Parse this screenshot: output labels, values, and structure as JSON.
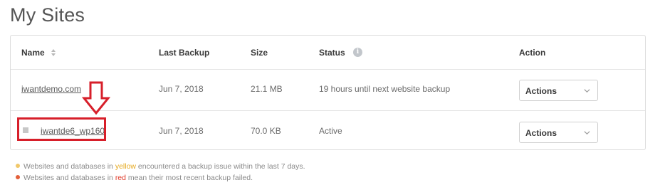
{
  "page": {
    "title": "My Sites"
  },
  "table": {
    "headers": {
      "name": "Name",
      "last_backup": "Last Backup",
      "size": "Size",
      "status": "Status",
      "action": "Action"
    },
    "rows": [
      {
        "name": "iwantdemo.com",
        "last_backup": "Jun 7, 2018",
        "size": "21.1 MB",
        "status": "19 hours until next website backup",
        "action": "Actions"
      },
      {
        "name": "iwantde6_wp160",
        "last_backup": "Jun 7, 2018",
        "size": "70.0 KB",
        "status": "Active",
        "action": "Actions"
      }
    ]
  },
  "legend": {
    "yellow": {
      "prefix": "Websites and databases in ",
      "keyword": "yellow",
      "suffix": " encountered a backup issue within the last 7 days.",
      "color": "#f1c86a"
    },
    "red": {
      "prefix": "Websites and databases in ",
      "keyword": "red",
      "suffix": " mean their most recent backup failed.",
      "color": "#e3603a"
    }
  },
  "icons": {
    "sort": "sort-icon",
    "info": "info-icon",
    "chevron": "chevron-down-icon",
    "annotation_arrow": "down-arrow-icon"
  },
  "colors": {
    "annotation": "#d71f2a",
    "border": "#dcdcdc"
  }
}
